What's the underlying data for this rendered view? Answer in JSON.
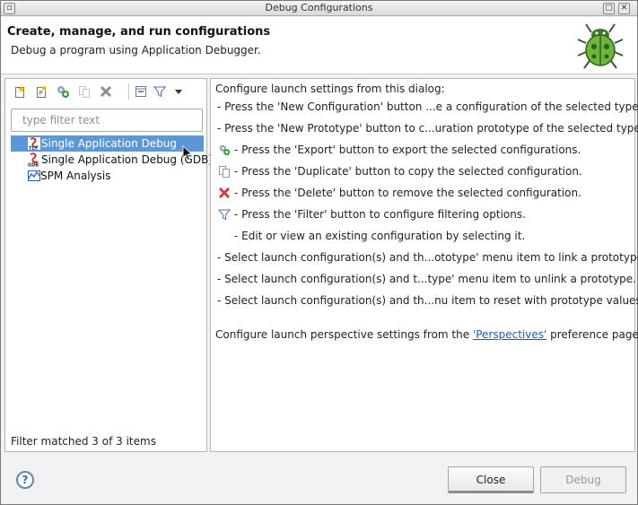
{
  "window": {
    "title": "Debug Configurations"
  },
  "header": {
    "title": "Create, manage, and run configurations",
    "subtitle": "Debug a program using Application Debugger.",
    "logo_icon": "bug-icon"
  },
  "left": {
    "toolbar": [
      {
        "name": "new-configuration-icon"
      },
      {
        "name": "new-prototype-icon"
      },
      {
        "name": "export-icon"
      },
      {
        "name": "duplicate-icon"
      },
      {
        "name": "delete-icon"
      },
      {
        "name": "collapse-all-icon"
      },
      {
        "name": "filter-icon"
      },
      {
        "name": "view-menu-icon"
      }
    ],
    "filter_placeholder": "type filter text",
    "tree": [
      {
        "label": "Single Application Debug",
        "icon": "tcf-launch-icon",
        "selected": true
      },
      {
        "label": "Single Application Debug (GDB)",
        "icon": "gdb-launch-icon",
        "selected": false
      },
      {
        "label": "SPM Analysis",
        "icon": "spm-analysis-icon",
        "selected": false
      }
    ],
    "filter_status": "Filter matched 3 of 3 items"
  },
  "right": {
    "intro": "Configure launch settings from this dialog:",
    "lines": [
      "- Press the 'New Configuration' button ...e a configuration of the selected type.",
      "- Press the 'New Prototype' button to c...uration prototype of the selected type.",
      "- Press the 'Export' button to export the selected configurations.",
      "- Press the 'Duplicate' button to copy the selected configuration.",
      "- Press the 'Delete' button to remove the selected configuration.",
      "- Press the 'Filter' button to configure filtering options.",
      "- Edit or view an existing configuration by selecting it.",
      "- Select launch configuration(s) and th...ototype' menu item to link a prototype.",
      "- Select launch configuration(s) and t...type' menu item to unlink a prototype.",
      "- Select launch configuration(s) and th...nu item to reset with prototype values."
    ],
    "perspective_prefix": "Configure launch perspective settings from the ",
    "perspective_link": "'Perspectives'",
    "perspective_suffix": " preference page."
  },
  "buttons": {
    "close": "Close",
    "debug": "Debug",
    "help": "?"
  }
}
